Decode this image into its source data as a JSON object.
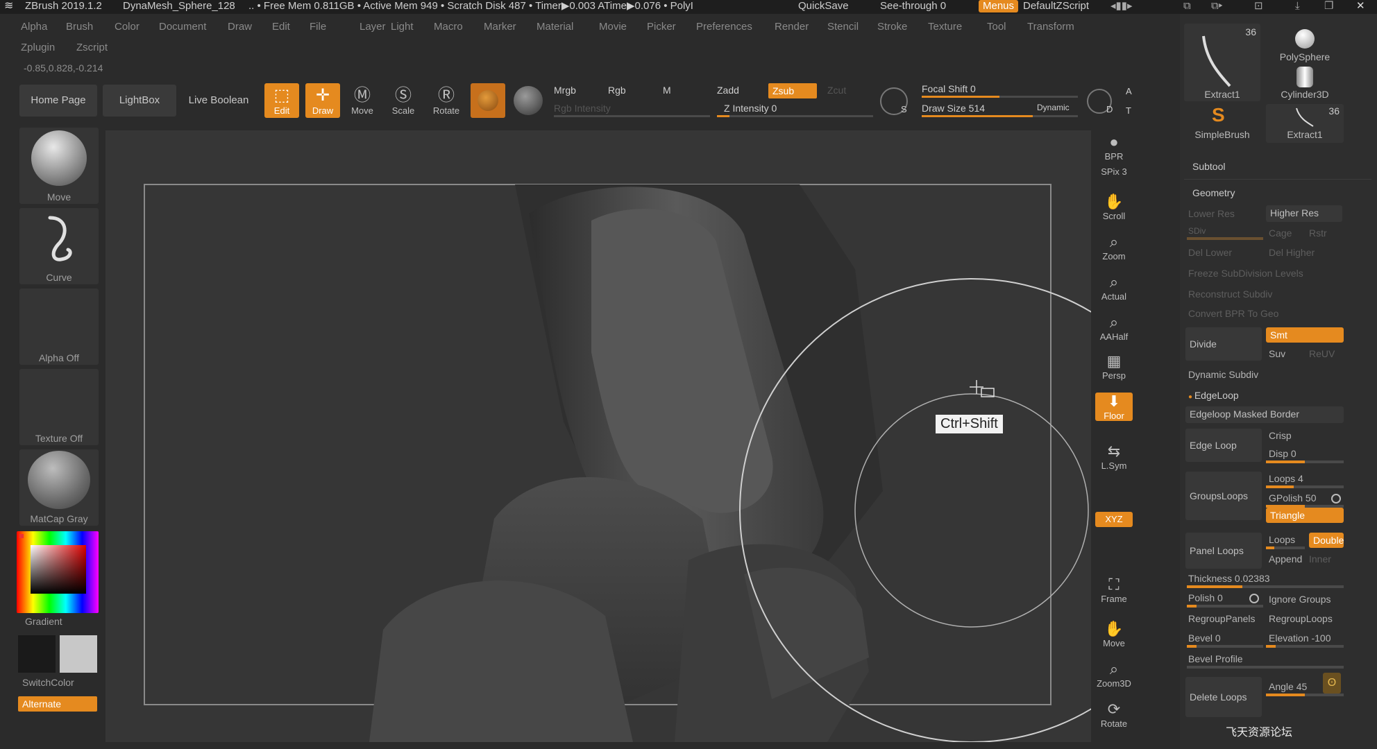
{
  "titlebar": {
    "app": "ZBrush 2019.1.2",
    "document": "DynaMesh_Sphere_128",
    "stats": ".. • Free Mem 0.811GB • Active Mem 949 • Scratch Disk 487 • Timer▶0.003 ATime▶0.076 • PolyI",
    "quicksave": "QuickSave",
    "seethrough": "See-through  0",
    "menus": "Menus",
    "zscript": "DefaultZScript"
  },
  "menu_row1": [
    "Alpha",
    "Brush",
    "Color",
    "Document",
    "Draw",
    "Edit",
    "File",
    "Layer",
    "Light",
    "Macro",
    "Marker",
    "Material",
    "Movie",
    "Picker",
    "Preferences",
    "Render",
    "Stencil",
    "Stroke",
    "Texture",
    "Tool",
    "Transform"
  ],
  "menu_row2": [
    "Zplugin",
    "Zscript"
  ],
  "coords": "-0.85,0.828,-0.214",
  "toolbar": {
    "home_page": "Home Page",
    "lightbox": "LightBox",
    "live_boolean": "Live Boolean",
    "edit": "Edit",
    "draw": "Draw",
    "move": "Move",
    "scale": "Scale",
    "rotate": "Rotate",
    "mrgb": "Mrgb",
    "rgb": "Rgb",
    "m": "M",
    "zadd": "Zadd",
    "zsub": "Zsub",
    "zcut": "Zcut",
    "rgb_intensity": "Rgb Intensity",
    "z_intensity": "Z Intensity 0",
    "focal_shift": "Focal Shift 0",
    "draw_size": "Draw Size 514",
    "dynamic": "Dynamic",
    "a": "A",
    "t": "T",
    "s": "S",
    "d": "D"
  },
  "left_panel": {
    "brush_label": "Move",
    "stroke_label": "Curve",
    "alpha_label": "Alpha Off",
    "texture_label": "Texture Off",
    "material_label": "MatCap Gray",
    "gradient_label": "Gradient",
    "switchcolor_label": "SwitchColor",
    "alternate_label": "Alternate"
  },
  "viewport": {
    "tooltip": "Ctrl+Shift"
  },
  "shelf": [
    {
      "label": "BPR"
    },
    {
      "label": "SPix 3"
    },
    {
      "label": "Scroll"
    },
    {
      "label": "Zoom"
    },
    {
      "label": "Actual"
    },
    {
      "label": "AAHalf"
    },
    {
      "label": "Persp"
    },
    {
      "label": "Floor"
    },
    {
      "label": "L.Sym"
    },
    {
      "label": "Move"
    },
    {
      "label": "Zoom3D"
    },
    {
      "label": "Rotate"
    }
  ],
  "shelf_xyz": "XYZ",
  "shelf_frame": "Frame",
  "tools": {
    "extract1_top": "Extract1",
    "extract1_top_count": "36",
    "polysphere": "PolySphere",
    "cylinder3d": "Cylinder3D",
    "simplebrush": "SimpleBrush",
    "extract1_bottom": "Extract1",
    "extract1_bottom_count": "36"
  },
  "subtool": {
    "subtool_header": "Subtool",
    "geometry_header": "Geometry",
    "lower_res": "Lower Res",
    "higher_res": "Higher Res",
    "sdiv": "SDiv",
    "cage": "Cage",
    "rstr": "Rstr",
    "del_lower": "Del Lower",
    "del_higher": "Del Higher",
    "freeze": "Freeze SubDivision Levels",
    "reconstruct": "Reconstruct Subdiv",
    "convert_bpr": "Convert BPR To Geo",
    "divide": "Divide",
    "smt": "Smt",
    "suv": "Suv",
    "reuv": "ReUV",
    "dynamic_subdiv": "Dynamic Subdiv",
    "edgeloop_header": "EdgeLoop",
    "edgeloop_masked_border": "Edgeloop Masked Border",
    "edge_loop": "Edge Loop",
    "crisp": "Crisp",
    "disp": "Disp 0",
    "groupsloops": "GroupsLoops",
    "loops4": "Loops 4",
    "gpolish": "GPolish 50",
    "triangle": "Triangle",
    "panel_loops": "Panel Loops",
    "loops": "Loops",
    "double": "Double",
    "append": "Append",
    "inner": "Inner",
    "thickness": "Thickness 0.02383",
    "polish": "Polish 0",
    "ignore_groups": "Ignore Groups",
    "regroup_panels": "RegroupPanels",
    "regroup_loops": "RegroupLoops",
    "bevel": "Bevel 0",
    "elevation": "Elevation -100",
    "bevel_profile": "Bevel Profile",
    "delete_loops": "Delete Loops",
    "angle": "Angle 45"
  },
  "watermark": "飞天资源论坛",
  "accent_color": "#e58a1f"
}
